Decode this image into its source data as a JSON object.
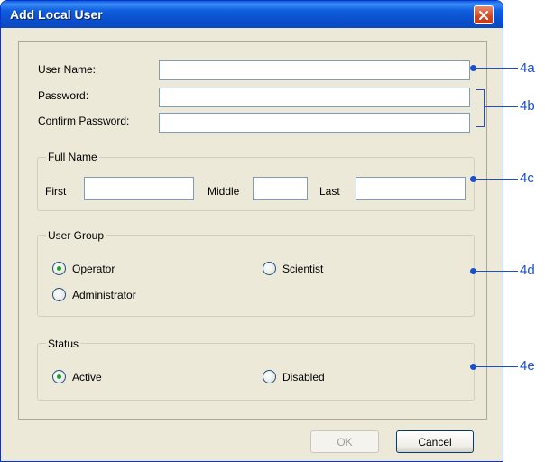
{
  "window": {
    "title": "Add Local User",
    "close_icon": "close-icon"
  },
  "fields": {
    "user_name_label": "User Name:",
    "user_name_value": "",
    "password_label": "Password:",
    "password_value": "",
    "confirm_password_label": "Confirm Password:",
    "confirm_password_value": ""
  },
  "full_name": {
    "legend": "Full Name",
    "first_label": "First",
    "first_value": "",
    "middle_label": "Middle",
    "middle_value": "",
    "last_label": "Last",
    "last_value": ""
  },
  "user_group": {
    "legend": "User Group",
    "options": [
      {
        "label": "Operator",
        "selected": true
      },
      {
        "label": "Scientist",
        "selected": false
      },
      {
        "label": "Administrator",
        "selected": false
      }
    ]
  },
  "status": {
    "legend": "Status",
    "options": [
      {
        "label": "Active",
        "selected": true
      },
      {
        "label": "Disabled",
        "selected": false
      }
    ]
  },
  "buttons": {
    "ok": "OK",
    "ok_enabled": false,
    "cancel": "Cancel"
  },
  "callouts": [
    "4a",
    "4b",
    "4c",
    "4d",
    "4e"
  ],
  "colors": {
    "title_bar": "#0a4fcc",
    "callout": "#1a4fd0",
    "selected_radio": "#21a121",
    "close_button": "#d3471f"
  }
}
